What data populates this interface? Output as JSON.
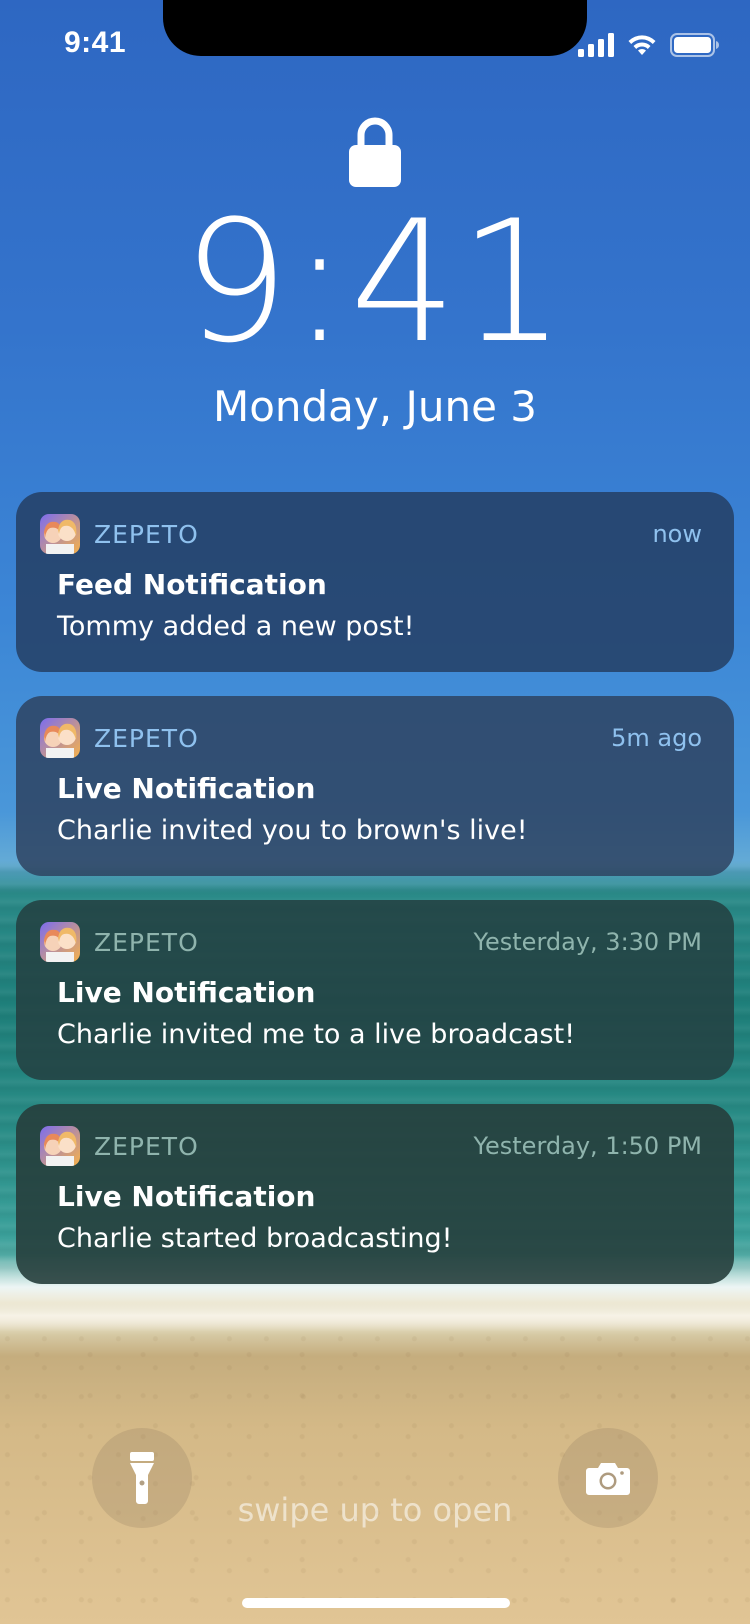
{
  "status_bar": {
    "time": "9:41"
  },
  "lock_screen": {
    "time": "9:41",
    "date": "Monday, June 3"
  },
  "notifications": [
    {
      "app": "ZEPETO",
      "time": "now",
      "title": "Feed Notification",
      "body": "Tommy added a new post!"
    },
    {
      "app": "ZEPETO",
      "time": "5m ago",
      "title": "Live Notification",
      "body": "Charlie invited you to brown's live!"
    },
    {
      "app": "ZEPETO",
      "time": "Yesterday, 3:30 PM",
      "title": "Live Notification",
      "body": "Charlie invited me to a live broadcast!"
    },
    {
      "app": "ZEPETO",
      "time": "Yesterday, 1:50 PM",
      "title": "Live Notification",
      "body": "Charlie started broadcasting!"
    }
  ],
  "bottom": {
    "swipe_hint": "swipe up to open"
  },
  "icons": {
    "flashlight": "flashlight-icon",
    "camera": "camera-icon",
    "lock": "lock-icon",
    "app": "zepeto-app-icon"
  },
  "colors": {
    "notification_time_blue": "#8fc1ee",
    "notification_time_teal": "#8fb4ad"
  }
}
